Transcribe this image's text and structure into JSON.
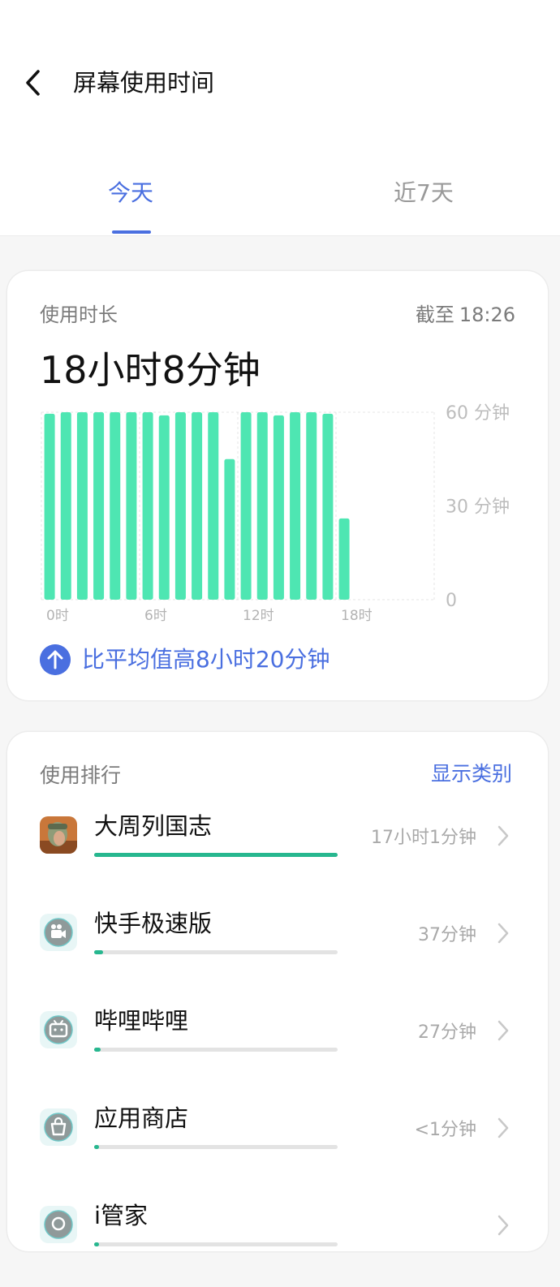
{
  "header": {
    "title": "屏幕使用时间"
  },
  "tabs": [
    {
      "label": "今天",
      "active": true
    },
    {
      "label": "近7天",
      "active": false
    }
  ],
  "usage": {
    "label": "使用时长",
    "as_of_label": "截至",
    "as_of_time": "18:26",
    "total": "18小时8分钟",
    "comparison": "比平均值高8小时20分钟"
  },
  "chart_data": {
    "type": "bar",
    "title": "",
    "xlabel": "",
    "ylabel": "",
    "x_tick_labels": [
      "0时",
      "6时",
      "12时",
      "18时"
    ],
    "y_tick_labels": [
      "60 分钟",
      "30 分钟",
      "0"
    ],
    "ylim": [
      0,
      60
    ],
    "categories": [
      "0",
      "1",
      "2",
      "3",
      "4",
      "5",
      "6",
      "7",
      "8",
      "9",
      "10",
      "11",
      "12",
      "13",
      "14",
      "15",
      "16",
      "17",
      "18",
      "19",
      "20",
      "21",
      "22",
      "23"
    ],
    "values": [
      59.5,
      60,
      60,
      60,
      60,
      60,
      60,
      59,
      60,
      60,
      60,
      45,
      60,
      60,
      59,
      60,
      60,
      59.5,
      26,
      0,
      0,
      0,
      0,
      0
    ],
    "color": "#4ee6b2"
  },
  "ranking": {
    "label": "使用排行",
    "show_category": "显示类别",
    "apps": [
      {
        "name": "大周列国志",
        "time": "17小时1分钟",
        "fraction": 1.0,
        "icon": "game-avatar-icon"
      },
      {
        "name": "快手极速版",
        "time": "37分钟",
        "fraction": 0.036,
        "icon": "camera-app-icon"
      },
      {
        "name": "哔哩哔哩",
        "time": "27分钟",
        "fraction": 0.026,
        "icon": "tv-app-icon"
      },
      {
        "name": "应用商店",
        "time": "<1分钟",
        "fraction": 0.008,
        "icon": "bag-app-icon"
      },
      {
        "name": "i管家",
        "time": "",
        "fraction": 0.005,
        "icon": "manager-app-icon"
      }
    ]
  },
  "colors": {
    "accent": "#4a6fe0",
    "bar": "#4ee6b2",
    "progress": "#27b78f"
  }
}
